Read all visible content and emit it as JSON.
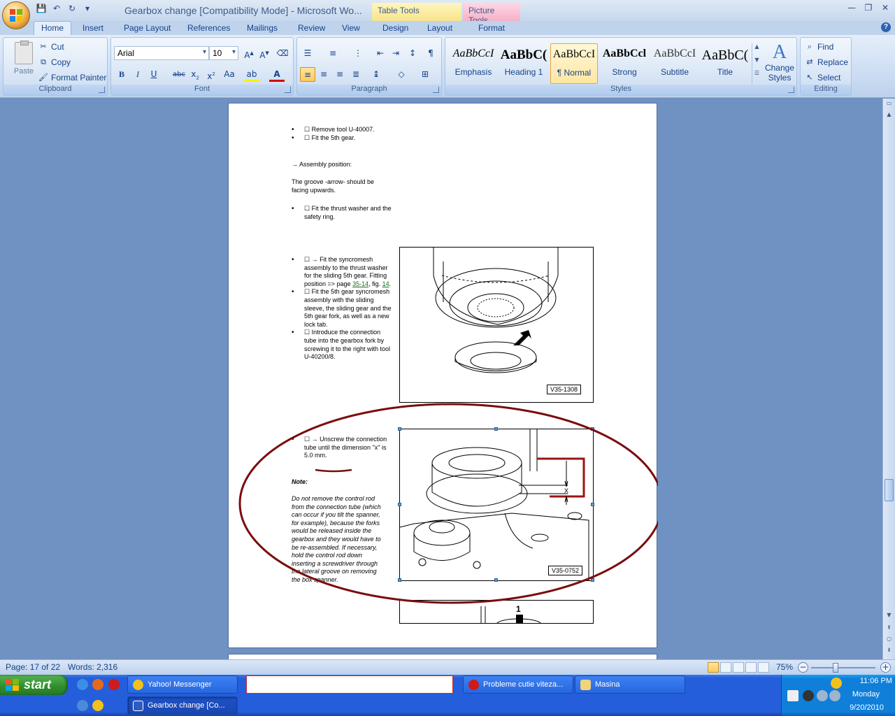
{
  "window": {
    "title": "Gearbox change [Compatibility Mode] - Microsoft Wo...",
    "context_tabs": [
      "Table Tools",
      "Picture Tools"
    ]
  },
  "quick_access": {
    "save": "💾",
    "undo": "↶",
    "redo": "↻",
    "customize": "▾"
  },
  "ribbon_tabs": [
    "Home",
    "Insert",
    "Page Layout",
    "References",
    "Mailings",
    "Review",
    "View",
    "Design",
    "Layout",
    "Format"
  ],
  "clipboard": {
    "paste": "Paste",
    "cut": "Cut",
    "copy": "Copy",
    "format_painter": "Format Painter",
    "label": "Clipboard"
  },
  "font": {
    "name": "Arial",
    "size": "10",
    "label": "Font"
  },
  "paragraph": {
    "label": "Paragraph"
  },
  "styles": {
    "label": "Styles",
    "items": [
      {
        "sample": "AaBbCcI",
        "name": "Emphasis"
      },
      {
        "sample": "AaBbC(",
        "name": "Heading 1"
      },
      {
        "sample": "AaBbCcI",
        "name": "¶ Normal"
      },
      {
        "sample": "AaBbCcl",
        "name": "Strong"
      },
      {
        "sample": "AaBbCcI",
        "name": "Subtitle"
      },
      {
        "sample": "AaBbC(",
        "name": "Title"
      }
    ],
    "change_styles": "Change Styles"
  },
  "editing": {
    "find": "Find",
    "replace": "Replace",
    "select": "Select",
    "label": "Editing"
  },
  "document": {
    "bullets_1": [
      "☐ Remove tool U-40007.",
      "☐ Fit the 5th gear."
    ],
    "assembly_position": "→ Assembly position:",
    "groove_text": "The groove -arrow- should be facing upwards.",
    "bullets_2": [
      "☐ Fit the thrust washer and the safety ring."
    ],
    "bullet_3a": "☐ → Fit the syncromesh assembly to the thrust washer for the sliding 5th gear. Fitting position => page ",
    "link_a": "35-14",
    "bullet_3b": ", fig. ",
    "link_b": "14",
    "bullet_3c": ".",
    "bullet_4": "☐ Fit the 5th gear syncromesh assembly with the sliding sleeve, the sliding gear and the 5th gear fork, as well as a new lock tab.",
    "bullet_5": "☐ Introduce the connection tube into the gearbox fork by screwing it to the right with tool U-40200/8.",
    "bullet_6": "☐ → Unscrew the connection tube until the dimension \"x\" is 5.0 mm.",
    "note_label": "Note:",
    "note_text": "Do not remove the control rod from the connection tube (which can occur if you tilt the spanner, for example), because the forks would be released inside the gearbox and they would have to be re-assembled. If necessary, hold the control rod down inserting a screwdriver through the lateral groove on removing the box spanner.",
    "figure_1_label": "V35-1308",
    "figure_2_label": "V35-0752",
    "figure_2_dim": "X",
    "figure_3_label": "1"
  },
  "status": {
    "page": "Page: 17 of 22",
    "words": "Words: 2,316",
    "zoom": "75%"
  },
  "taskbar": {
    "start": "start",
    "items": [
      "Yahoo! Messenger",
      "Probleme cutie viteza...",
      "Masina",
      "Gearbox change [Co..."
    ],
    "clock_time": "11:06 PM",
    "clock_day": "Monday",
    "clock_date": "9/20/2010"
  },
  "colors": {
    "ribbon": "#c9dbf2",
    "workspace": "#6f92c2",
    "annotation": "#7a0d0d",
    "taskbar": "#245edb"
  }
}
